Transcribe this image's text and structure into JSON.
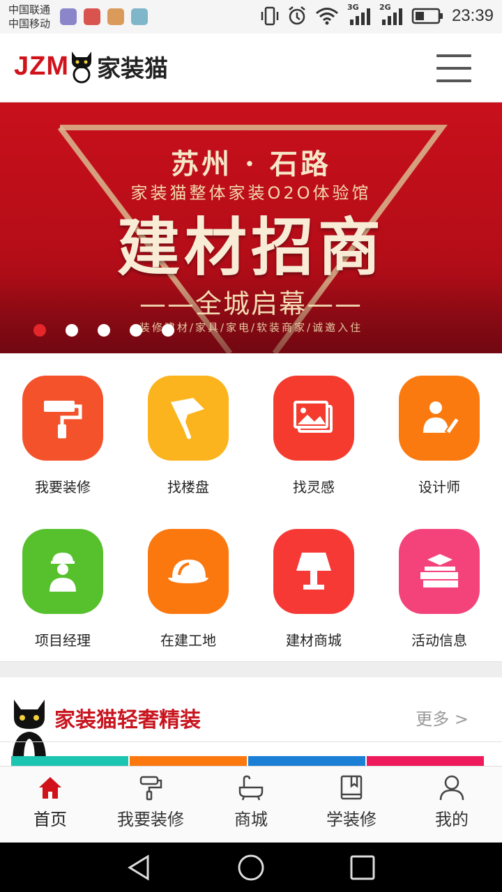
{
  "status_bar": {
    "carrier1": "中国联通",
    "carrier2": "中国移动",
    "network1": "3G",
    "network2": "2G",
    "time": "23:39",
    "app_icon_colors": [
      "#8b86c9",
      "#d9534f",
      "#d99a5a",
      "#7fb6c9"
    ]
  },
  "header": {
    "logo_en": "JZM",
    "logo_cn": "家装猫",
    "brand_color": "#d0121b"
  },
  "banner": {
    "line1": "苏州 · 石路",
    "line2": "家装猫整体家装O2O体验馆",
    "line3": "建材招商",
    "line4": "——全城启幕——",
    "line5": "装修建材/家具/家电/软装商家/诚邀入住",
    "slide_count": 5,
    "active_slide": 1
  },
  "grid": [
    {
      "label": "我要装修",
      "icon": "paint-roller-icon",
      "color": "#f4522b"
    },
    {
      "label": "找楼盘",
      "icon": "flag-icon",
      "color": "#fbb41d"
    },
    {
      "label": "找灵感",
      "icon": "gallery-icon",
      "color": "#f43b2e"
    },
    {
      "label": "设计师",
      "icon": "designer-icon",
      "color": "#fb7a10"
    },
    {
      "label": "项目经理",
      "icon": "worker-icon",
      "color": "#56c12c"
    },
    {
      "label": "在建工地",
      "icon": "hardhat-icon",
      "color": "#fb780f"
    },
    {
      "label": "建材商城",
      "icon": "lamp-icon",
      "color": "#f73936"
    },
    {
      "label": "活动信息",
      "icon": "books-icon",
      "color": "#f3437a"
    }
  ],
  "section": {
    "title": "家装猫轻奢精装",
    "more": "更多 >",
    "stripe_colors": [
      "#1cc5b0",
      "#fb780f",
      "#1c7fd6",
      "#ef1a5c"
    ]
  },
  "tabbar": [
    {
      "label": "首页",
      "icon": "home-icon",
      "active": true
    },
    {
      "label": "我要装修",
      "icon": "paint-roller-icon",
      "active": false
    },
    {
      "label": "商城",
      "icon": "bathtub-icon",
      "active": false
    },
    {
      "label": "学装修",
      "icon": "book-icon",
      "active": false
    },
    {
      "label": "我的",
      "icon": "user-icon",
      "active": false
    }
  ]
}
